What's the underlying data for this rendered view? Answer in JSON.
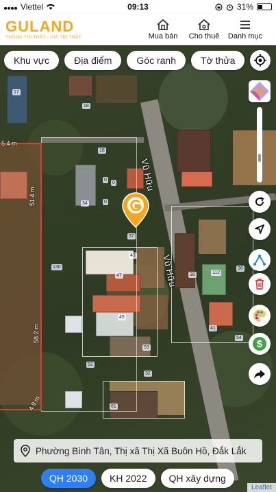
{
  "status": {
    "carrier": "Viettel",
    "time": "09:13",
    "battery": "31%",
    "battery_level": 0.31
  },
  "header": {
    "logo_name": "GULAND",
    "logo_tagline": "THÔNG TIN THẬT - GIÁ TRỊ THẬT",
    "nav": [
      {
        "label": "Mua bán",
        "icon": "house-icon"
      },
      {
        "label": "Cho thuê",
        "icon": "rent-house-icon"
      },
      {
        "label": "Danh mục",
        "icon": "menu-icon"
      }
    ]
  },
  "filters": [
    "Khu vực",
    "Địa điểm",
    "Góc ranh",
    "Tờ thửa"
  ],
  "map": {
    "streets": [
      "Vũ Hữu",
      "Vũ Hữu"
    ],
    "measurements": [
      "5.4 m",
      "51.4 m",
      "58.2 m",
      "4.9 m"
    ],
    "lots": [
      "17",
      "18",
      "18",
      "0",
      "0",
      "0",
      "34",
      "37",
      "130",
      "43",
      "47",
      "38",
      "112",
      "36",
      "41",
      "45",
      "53",
      "52",
      "32",
      "61",
      "54"
    ]
  },
  "address": "Phường Bình Tân, Thị xã Thị Xã Buôn Hồ, Đắk Lắk",
  "bottom_tabs": [
    {
      "label": "QH 2030",
      "active": true
    },
    {
      "label": "KH 2022",
      "active": false
    },
    {
      "label": "QH xây dựng",
      "active": false
    }
  ],
  "attribution": "Leaflet",
  "colors": {
    "brand": "#f5a623",
    "active_tab": "#2f7ff0",
    "boundary": "#e53935"
  }
}
